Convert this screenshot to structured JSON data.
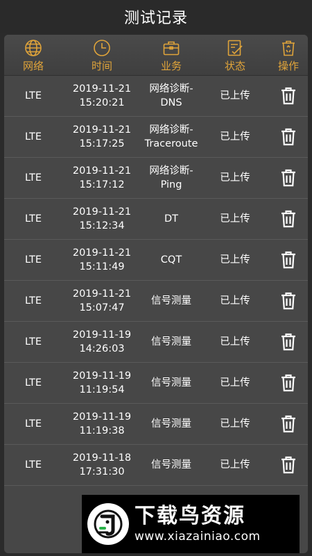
{
  "app": {
    "title": "测试记录"
  },
  "header": {
    "network": "网络",
    "time": "时间",
    "business": "业务",
    "status": "状态",
    "action": "操作"
  },
  "accent_color": "#e0a43a",
  "records": [
    {
      "network": "LTE",
      "date": "2019-11-21",
      "time": "15:20:21",
      "business_line1": "网络诊断-",
      "business_line2": "DNS",
      "status": "已上传"
    },
    {
      "network": "LTE",
      "date": "2019-11-21",
      "time": "15:17:25",
      "business_line1": "网络诊断-",
      "business_line2": "Traceroute",
      "status": "已上传"
    },
    {
      "network": "LTE",
      "date": "2019-11-21",
      "time": "15:17:12",
      "business_line1": "网络诊断-",
      "business_line2": "Ping",
      "status": "已上传"
    },
    {
      "network": "LTE",
      "date": "2019-11-21",
      "time": "15:12:34",
      "business_line1": "DT",
      "business_line2": "",
      "status": "已上传"
    },
    {
      "network": "LTE",
      "date": "2019-11-21",
      "time": "15:11:49",
      "business_line1": "CQT",
      "business_line2": "",
      "status": "已上传"
    },
    {
      "network": "LTE",
      "date": "2019-11-21",
      "time": "15:07:47",
      "business_line1": "信号测量",
      "business_line2": "",
      "status": "已上传"
    },
    {
      "network": "LTE",
      "date": "2019-11-19",
      "time": "14:26:03",
      "business_line1": "信号测量",
      "business_line2": "",
      "status": "已上传"
    },
    {
      "network": "LTE",
      "date": "2019-11-19",
      "time": "11:19:54",
      "business_line1": "信号测量",
      "business_line2": "",
      "status": "已上传"
    },
    {
      "network": "LTE",
      "date": "2019-11-19",
      "time": "11:19:38",
      "business_line1": "信号测量",
      "business_line2": "",
      "status": "已上传"
    },
    {
      "network": "LTE",
      "date": "2019-11-18",
      "time": "17:31:30",
      "business_line1": "信号测量",
      "business_line2": "",
      "status": "已上传"
    }
  ],
  "watermark": {
    "name": "下载鸟资源",
    "url": "www.xiazainiao.com"
  }
}
